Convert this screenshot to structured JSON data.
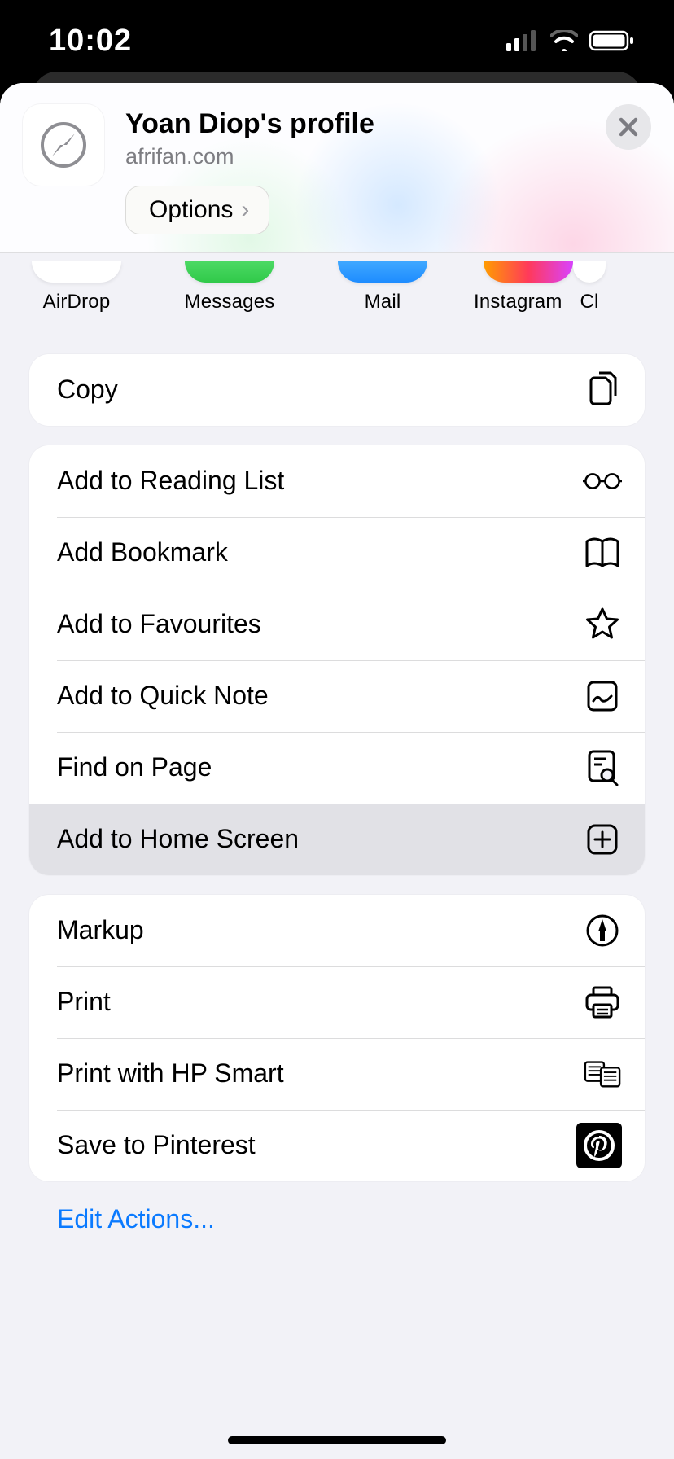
{
  "status": {
    "time": "10:02"
  },
  "header": {
    "title": "Yoan Diop's profile",
    "subtitle": "afrifan.com",
    "options_label": "Options"
  },
  "share_apps": {
    "airdrop": "AirDrop",
    "messages": "Messages",
    "mail": "Mail",
    "instagram": "Instagram",
    "overflow": "Cl"
  },
  "actions": {
    "copy": "Copy",
    "reading_list": "Add to Reading List",
    "bookmark": "Add Bookmark",
    "favourites": "Add to Favourites",
    "quick_note": "Add to Quick Note",
    "find": "Find on Page",
    "home_screen": "Add to Home Screen",
    "markup": "Markup",
    "print": "Print",
    "print_hp": "Print with HP Smart",
    "pinterest": "Save to Pinterest"
  },
  "footer": {
    "edit": "Edit Actions..."
  }
}
